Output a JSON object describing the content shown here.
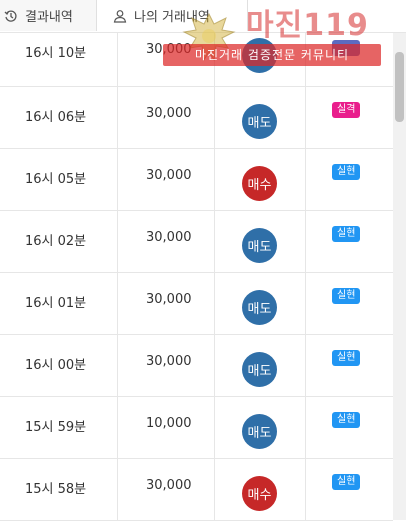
{
  "tabs": [
    {
      "label": "결과내역",
      "icon": "history-icon"
    },
    {
      "label": "나의 거래내역",
      "icon": "user-icon"
    }
  ],
  "rows": [
    {
      "time": "16시 10분",
      "amount": "30,000",
      "action": "",
      "result": ""
    },
    {
      "time": "16시 06분",
      "amount": "30,000",
      "action": "매도",
      "result": "실격"
    },
    {
      "time": "16시 05분",
      "amount": "30,000",
      "action": "매수",
      "result": "실현"
    },
    {
      "time": "16시 02분",
      "amount": "30,000",
      "action": "매도",
      "result": "실현"
    },
    {
      "time": "16시 01분",
      "amount": "30,000",
      "action": "매도",
      "result": "실현"
    },
    {
      "time": "16시 00분",
      "amount": "30,000",
      "action": "매도",
      "result": "실현"
    },
    {
      "time": "15시 59분",
      "amount": "10,000",
      "action": "매도",
      "result": "실현"
    },
    {
      "time": "15시 58분",
      "amount": "30,000",
      "action": "매수",
      "result": "실현"
    }
  ],
  "watermark": {
    "title": "마진119",
    "banner": "마진거래 검증전문 커뮤니티"
  },
  "colors": {
    "sell": "#2f6fa8",
    "buy": "#c62828",
    "realized": "#2196f3",
    "disqualified": "#e91e8c",
    "first_row_badge": "#5c6bc0"
  }
}
